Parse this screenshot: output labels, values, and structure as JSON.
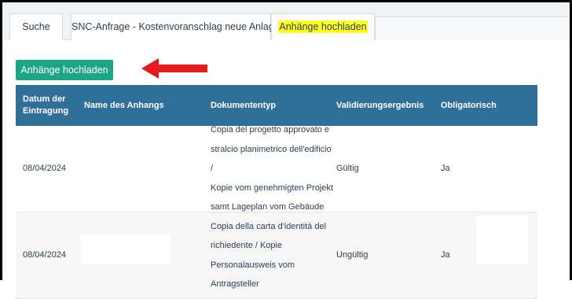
{
  "tabs": [
    {
      "label": "Suche"
    },
    {
      "label": "SNC-Anfrage - Kostenvoranschlag neue Anlage"
    },
    {
      "label": "Anhänge hochladen",
      "active": true,
      "highlight": "#ffff26"
    }
  ],
  "upload_button": {
    "label": "Anhänge hochladen",
    "color": "#1ea684"
  },
  "table": {
    "header_color": "#2f6f98",
    "columns": [
      {
        "label": "Datum der Eintragung"
      },
      {
        "label": "Name des Anhangs"
      },
      {
        "label": "Dokumententyp"
      },
      {
        "label": "Validierungsergebnis"
      },
      {
        "label": "Obligatorisch"
      }
    ],
    "rows": [
      {
        "date": "08/04/2024",
        "name": "",
        "doc_lines": [
          "Copia del progetto approvato e",
          "stralcio planimetrico dell'edificio /",
          "Kopie vom genehmigten Projekt",
          "samt Lageplan vom Gebäude"
        ],
        "validation": "Gültig",
        "mandatory": "Ja"
      },
      {
        "date": "08/04/2024",
        "name": "",
        "doc_lines": [
          "Copia della carta d'identità del",
          "richiedente / Kopie",
          "Personalausweis vom Antragsteller"
        ],
        "validation": "Ungültig",
        "mandatory": "Ja"
      }
    ]
  },
  "annotation": {
    "arrow_color": "#e31b1b",
    "arrow_direction": "left"
  }
}
